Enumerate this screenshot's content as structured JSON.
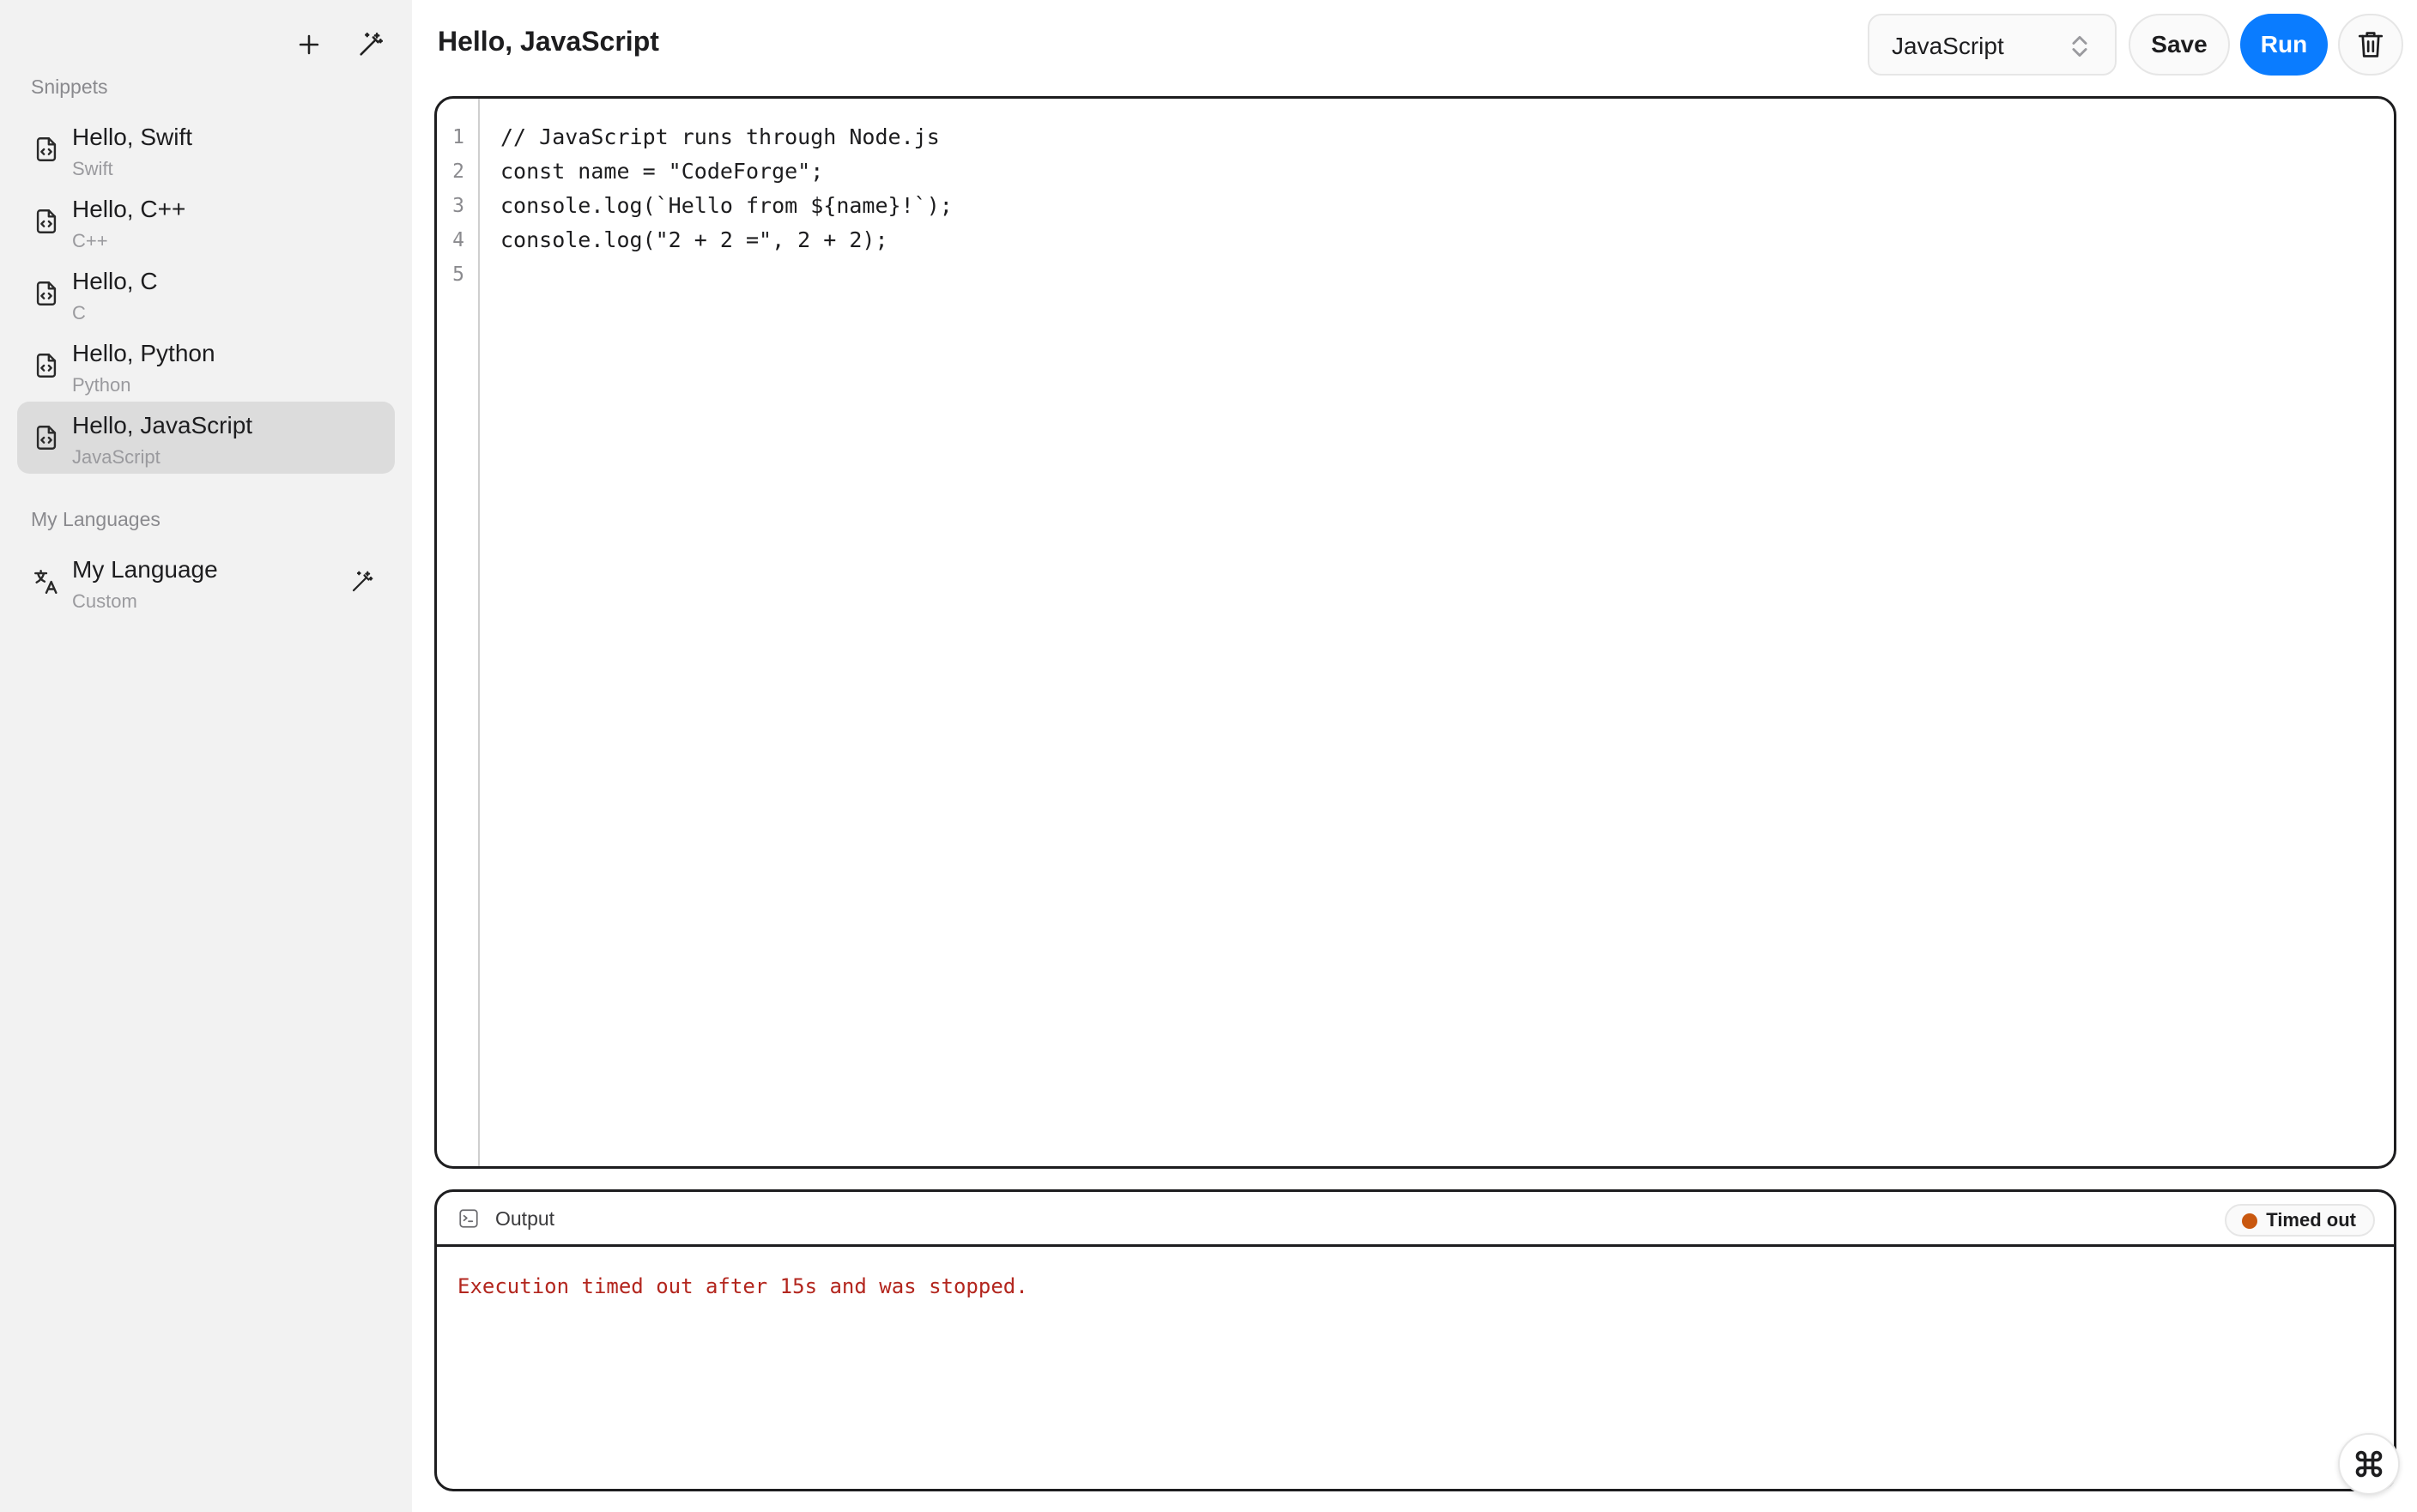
{
  "sidebar": {
    "add_icon": "plus-icon",
    "magic_icon": "magic-wand-icon",
    "snippets_label": "Snippets",
    "snippets": [
      {
        "title": "Hello, Swift",
        "subtitle": "Swift",
        "icon": "code-file-icon"
      },
      {
        "title": "Hello, C++",
        "subtitle": "C++",
        "icon": "code-file-icon"
      },
      {
        "title": "Hello, C",
        "subtitle": "C",
        "icon": "code-file-icon"
      },
      {
        "title": "Hello, Python",
        "subtitle": "Python",
        "icon": "code-file-icon"
      },
      {
        "title": "Hello, JavaScript",
        "subtitle": "JavaScript",
        "icon": "code-file-icon",
        "active": true
      }
    ],
    "languages_label": "My Languages",
    "languages": [
      {
        "title": "My Language",
        "subtitle": "Custom",
        "icon": "translate-icon",
        "action_icon": "magic-wand-icon"
      }
    ]
  },
  "header": {
    "title": "Hello, JavaScript",
    "language_select": {
      "value": "JavaScript",
      "icon": "chevron-up-down-icon"
    },
    "save_label": "Save",
    "run_label": "Run",
    "delete_icon": "trash-icon",
    "run_color": "#0a7cff"
  },
  "editor": {
    "line_numbers": [
      "1",
      "2",
      "3",
      "4",
      "5"
    ],
    "lines": [
      "// JavaScript runs through Node.js",
      "const name = \"CodeForge\";",
      "console.log(`Hello from ${name}!`);",
      "console.log(\"2 + 2 =\", 2 + 2);",
      ""
    ]
  },
  "output": {
    "icon": "terminal-icon",
    "label": "Output",
    "status": "Timed out",
    "status_color": "#c9580f",
    "message": "Execution timed out after 15s and was stopped.",
    "message_color": "#b3261e"
  },
  "floating_button": {
    "icon": "command-icon"
  }
}
